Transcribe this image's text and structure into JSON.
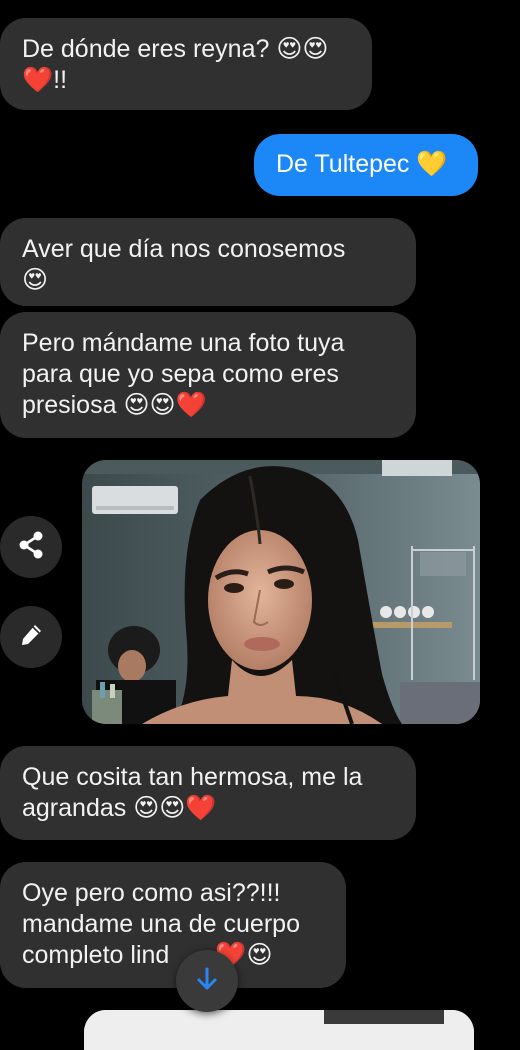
{
  "messages": {
    "m1": {
      "line1": "De dónde eres reyna? 😍😍",
      "line2": "❤️!!"
    },
    "m2": {
      "text": "De Tultepec 💛"
    },
    "m3": {
      "line1": "Aver que día nos conosemos",
      "line2": "😍"
    },
    "m4": {
      "line1": "Pero mándame una foto tuya",
      "line2": "para que yo sepa como eres",
      "line3": "presiosa 😍😍❤️"
    },
    "m5": {
      "line1": "Que cosita tan hermosa, me la",
      "line2": "agrandas 😍😍❤️"
    },
    "m6": {
      "line1": "Oye pero como asi??!!!",
      "line2": "mandame una de cuerpo",
      "line3": "completo lind",
      "line3_tail": "❤️😍"
    }
  },
  "photo": {
    "description_icon": "selfie-photo"
  },
  "actions": {
    "share_icon": "share-icon",
    "edit_icon": "pencil-icon",
    "scroll_icon": "arrow-down-icon"
  },
  "colors": {
    "received_bubble": "#303030",
    "sent_bubble": "#1c87f6",
    "background": "#000000",
    "scroll_arrow": "#2a86f5"
  }
}
